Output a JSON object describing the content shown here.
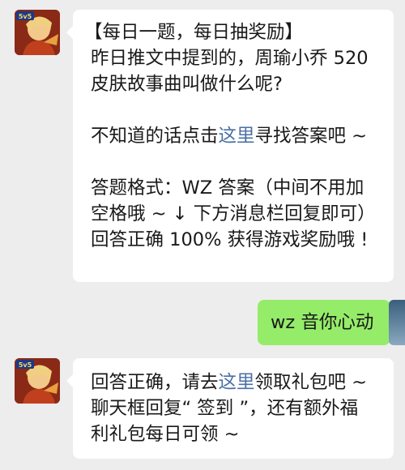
{
  "colors": {
    "background": "#ededed",
    "incoming_bubble": "#ffffff",
    "outgoing_bubble": "#95ec69",
    "link": "#4a6fa5",
    "text": "#191919"
  },
  "messages": [
    {
      "sender": "official-account",
      "avatar_icon": "game-hero-avatar-icon",
      "avatar_badge": "5v5",
      "lines": [
        "【每日一题，每日抽奖励】",
        "昨日推文中提到的，周瑜小乔 520",
        "皮肤故事曲叫做什么呢?"
      ],
      "line2_prefix": "不知道的话点击",
      "line2_link": "这里",
      "line2_suffix": "寻找答案吧 ~",
      "lines3": [
        "答题格式：WZ 答案（中间不用加",
        "空格哦 ~ ↓ 下方消息栏回复即可）",
        "回答正确 100% 获得游戏奖励哦 !"
      ]
    },
    {
      "sender": "me",
      "text": "wz 音你心动"
    },
    {
      "sender": "official-account",
      "avatar_icon": "game-hero-avatar-icon",
      "avatar_badge": "5v5",
      "line1_prefix": "回答正确，请去",
      "line1_link": "这里",
      "line1_suffix": "领取礼包吧 ~",
      "lines": [
        "聊天框回复“ 签到 ”，还有额外福",
        "利礼包每日可领 ~"
      ]
    }
  ]
}
